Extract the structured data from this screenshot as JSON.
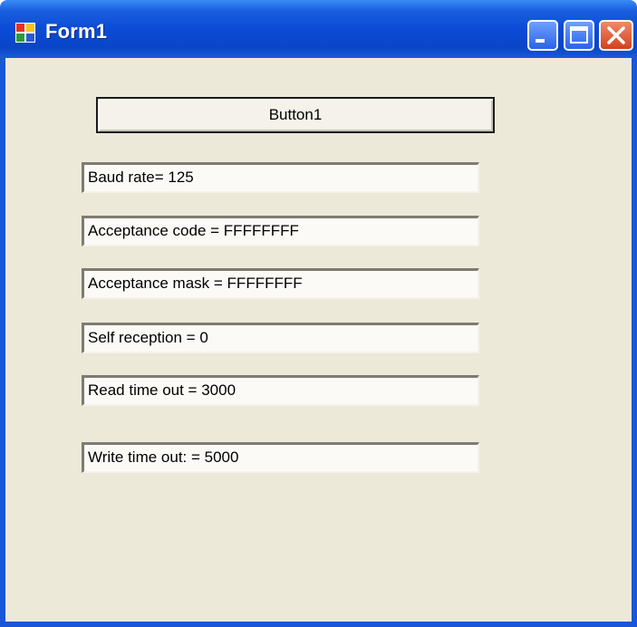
{
  "window": {
    "title": "Form1",
    "icon": "winforms-app-icon",
    "controls": [
      "minimize-icon",
      "maximize-icon",
      "close-icon"
    ]
  },
  "form": {
    "button_label": "Button1",
    "fields": [
      "Baud rate= 125",
      "Acceptance code = FFFFFFFF",
      "Acceptance mask = FFFFFFFF",
      "Self reception = 0",
      "Read time out = 3000",
      "Write time out: = 5000"
    ]
  },
  "colors": {
    "titlebar": "#0b4bd6",
    "client_background": "#ece9d8",
    "close_button": "#d2411c"
  }
}
